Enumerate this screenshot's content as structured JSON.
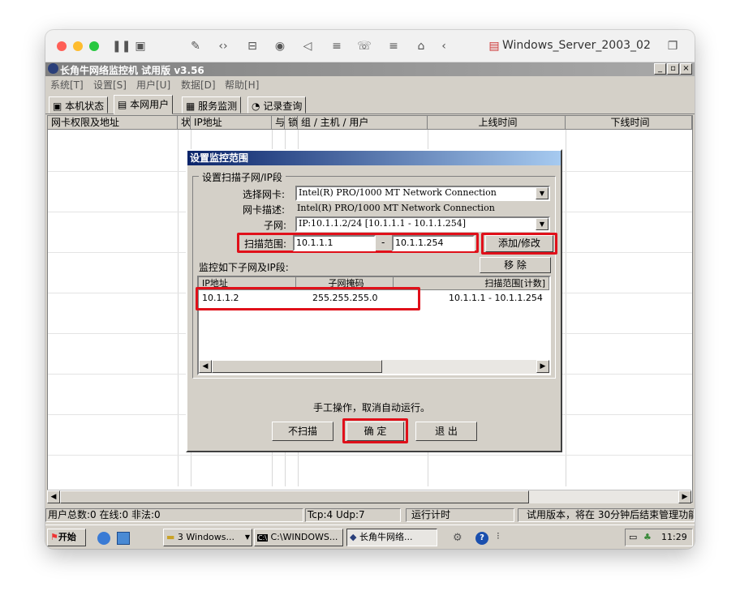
{
  "mac": {
    "window_title": "Windows_Server_2003_02"
  },
  "app": {
    "title": "长角牛网络监控机 试用版 v3.56"
  },
  "caption_buttons": [
    "_",
    "▫",
    "×"
  ],
  "menu": [
    "系统[T]",
    "设置[S]",
    "用户[U]",
    "数据[D]",
    "帮助[H]"
  ],
  "tabs": [
    "本机状态",
    "本网用户",
    "服务监测",
    "记录查询"
  ],
  "list_headers": [
    "网卡权限及地址",
    "状",
    "IP地址",
    "与",
    "锁",
    "组 / 主机 / 用户",
    "上线时间",
    "下线时间"
  ],
  "status": {
    "users": "用户总数:0 在线:0 非法:0",
    "tcp": "Tcp:4 Udp:7",
    "run": "运行计时",
    "trial": "试用版本，将在 30分钟后结束管理功能"
  },
  "taskbar": {
    "start": "开始",
    "items": [
      "3 Windows...",
      "C:\\WINDOWS...",
      "长角牛网络..."
    ],
    "clock": "11:29"
  },
  "dialog": {
    "title": "设置监控范围",
    "group_label": "设置扫描子网/IP段",
    "nic_label": "选择网卡:",
    "nic_value": "Intel(R) PRO/1000 MT Network Connection",
    "desc_label": "网卡描述:",
    "desc_value": "Intel(R) PRO/1000 MT Network Connection",
    "subnet_label": "子网:",
    "subnet_value": "IP:10.1.1.2/24 [10.1.1.1 - 10.1.1.254]",
    "range_label": "扫描范围:",
    "range_start": "10.1.1.1",
    "range_dash": "-",
    "range_end": "10.1.1.254",
    "add_button": "添加/修改",
    "remove_button": "移 除",
    "monitor_label": "监控如下子网及IP段:",
    "list_headers": [
      "IP地址",
      "子网掩码",
      "扫描范围[计数]"
    ],
    "rows": [
      {
        "ip": "10.1.1.2",
        "mask": "255.255.255.0",
        "range": "10.1.1.1 - 10.1.1.254"
      }
    ],
    "manual_note": "手工操作，取消自动运行。",
    "no_scan_button": "不扫描",
    "ok_button": "确 定",
    "exit_button": "退 出"
  },
  "colors": {
    "highlight_box": "#e0101a",
    "dialog_title_start": "#0a246a",
    "dialog_title_end": "#a6caf0"
  }
}
